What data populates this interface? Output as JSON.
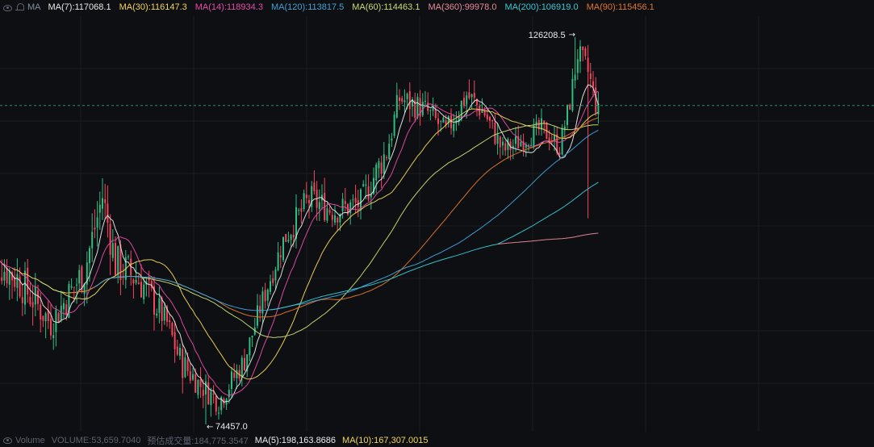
{
  "header": {
    "label": "MA",
    "ma": [
      {
        "label": "MA(7):117068.1",
        "color": "#e8e8e8"
      },
      {
        "label": "MA(30):116147.3",
        "color": "#f0d65a"
      },
      {
        "label": "MA(14):118934.3",
        "color": "#e64ca8"
      },
      {
        "label": "MA(120):113817.5",
        "color": "#3ea3d8"
      },
      {
        "label": "MA(60):114463.1",
        "color": "#c9de74"
      },
      {
        "label": "MA(360):99978.0",
        "color": "#e88a9c"
      },
      {
        "label": "MA(200):106919.0",
        "color": "#36c9d6"
      },
      {
        "label": "MA(90):115456.1",
        "color": "#e0762e"
      }
    ]
  },
  "markers": {
    "high": "126208.5",
    "low": "74457.0"
  },
  "volume_bar": {
    "title": "Volume",
    "volume": "VOLUME:53,659.7040",
    "estimate_label": "预估成交量:184,775.3547",
    "ma5": "MA(5):198,163.8686",
    "ma10": "MA(10):167,307.0015"
  },
  "colors": {
    "up": "#2ebd85",
    "down": "#f6465d",
    "current_price_line": "#2ebd85"
  },
  "chart_data": {
    "type": "candlestick",
    "ylim": [
      73500,
      129000
    ],
    "current_price": 117068.1,
    "grid": true,
    "annotations": [
      {
        "label": "126208.5",
        "type": "highest-high"
      },
      {
        "label": "74457.0",
        "type": "lowest-low"
      }
    ],
    "anchors": [
      [
        0,
        97000,
        4000
      ],
      [
        12,
        94000,
        5000
      ],
      [
        25,
        88000,
        4000
      ],
      [
        38,
        95000,
        5000
      ],
      [
        45,
        105000,
        5000
      ],
      [
        50,
        96000,
        5000
      ],
      [
        60,
        93500,
        5000
      ],
      [
        70,
        88000,
        3000
      ],
      [
        75,
        83000,
        4000
      ],
      [
        82,
        80000,
        3000
      ],
      [
        90,
        77500,
        3000
      ],
      [
        100,
        83000,
        3000
      ],
      [
        106,
        90000,
        3000
      ],
      [
        115,
        99000,
        3000
      ],
      [
        125,
        104500,
        4000
      ],
      [
        135,
        103000,
        3500
      ],
      [
        145,
        104000,
        3500
      ],
      [
        155,
        111000,
        4000
      ],
      [
        160,
        118000,
        3500
      ],
      [
        170,
        116500,
        3000
      ],
      [
        178,
        113500,
        3000
      ],
      [
        186,
        118500,
        3500
      ],
      [
        193,
        116000,
        3000
      ],
      [
        200,
        111000,
        3000
      ],
      [
        208,
        112500,
        2500
      ],
      [
        215,
        114000,
        2500
      ],
      [
        222,
        111500,
        2500
      ],
      [
        226,
        117500,
        2500
      ],
      [
        229,
        124000,
        3000
      ],
      [
        233,
        121500,
        3500
      ],
      [
        237,
        116000,
        3000
      ]
    ],
    "special_candles": [
      {
        "index": 85,
        "low": 74457.0
      },
      {
        "index": 228,
        "high": 126208.5
      },
      {
        "index": 233,
        "low": 102000
      }
    ],
    "series": [
      {
        "name": "MA(7)",
        "period": 7,
        "value": 117068.1,
        "color": "#e8e8e8"
      },
      {
        "name": "MA(14)",
        "period": 14,
        "value": 118934.3,
        "color": "#e64ca8"
      },
      {
        "name": "MA(30)",
        "period": 30,
        "value": 116147.3,
        "color": "#f0d65a"
      },
      {
        "name": "MA(60)",
        "period": 60,
        "value": 114463.1,
        "color": "#c9de74"
      },
      {
        "name": "MA(90)",
        "period": 90,
        "value": 115456.1,
        "color": "#e0762e"
      },
      {
        "name": "MA(120)",
        "period": 120,
        "value": 113817.5,
        "color": "#3ea3d8"
      },
      {
        "name": "MA(200)",
        "period": 200,
        "value": 106919.0,
        "color": "#36c9d6"
      },
      {
        "name": "MA(360)",
        "period": 360,
        "value": 99978.0,
        "color": "#e88a9c"
      }
    ]
  }
}
